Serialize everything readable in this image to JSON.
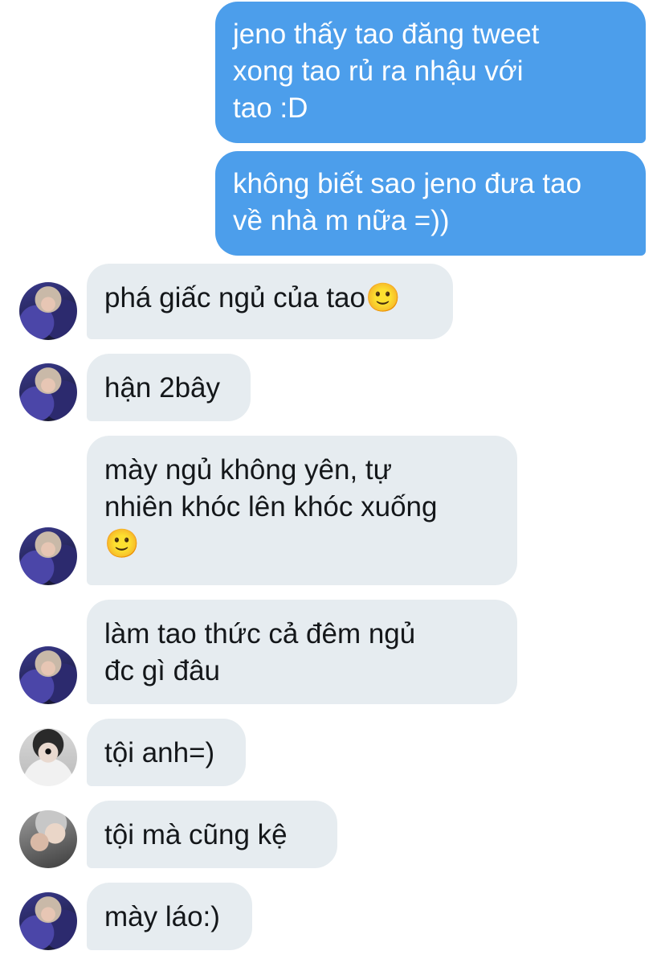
{
  "messages": [
    {
      "direction": "out",
      "text": "jeno thấy tao đăng tweet\nxong tao rủ ra nhậu với\ntao :D"
    },
    {
      "direction": "out",
      "text": "không biết sao jeno đưa tao\nvề nhà m nữa =))"
    },
    {
      "direction": "in",
      "avatar": "user-a-avatar",
      "text": "phá giấc ngủ của tao🙂"
    },
    {
      "direction": "in",
      "avatar": "user-a-avatar",
      "text": "hận 2bây"
    },
    {
      "direction": "in",
      "avatar": "user-a-avatar",
      "text": "mày ngủ không yên, tự\nnhiên khóc lên khóc xuống\n🙂"
    },
    {
      "direction": "in",
      "avatar": "user-a-avatar",
      "text": "làm tao thức cả đêm ngủ\nđc gì đâu"
    },
    {
      "direction": "in",
      "avatar": "user-b-avatar",
      "text": "tội anh=)"
    },
    {
      "direction": "in",
      "avatar": "user-c-avatar",
      "text": "tội mà cũng kệ"
    },
    {
      "direction": "in",
      "avatar": "user-a-avatar",
      "text": "mày láo:)"
    }
  ],
  "colors": {
    "outgoing_bubble": "#4c9eeb",
    "incoming_bubble": "#e6ecf0",
    "incoming_text": "#14171a"
  }
}
